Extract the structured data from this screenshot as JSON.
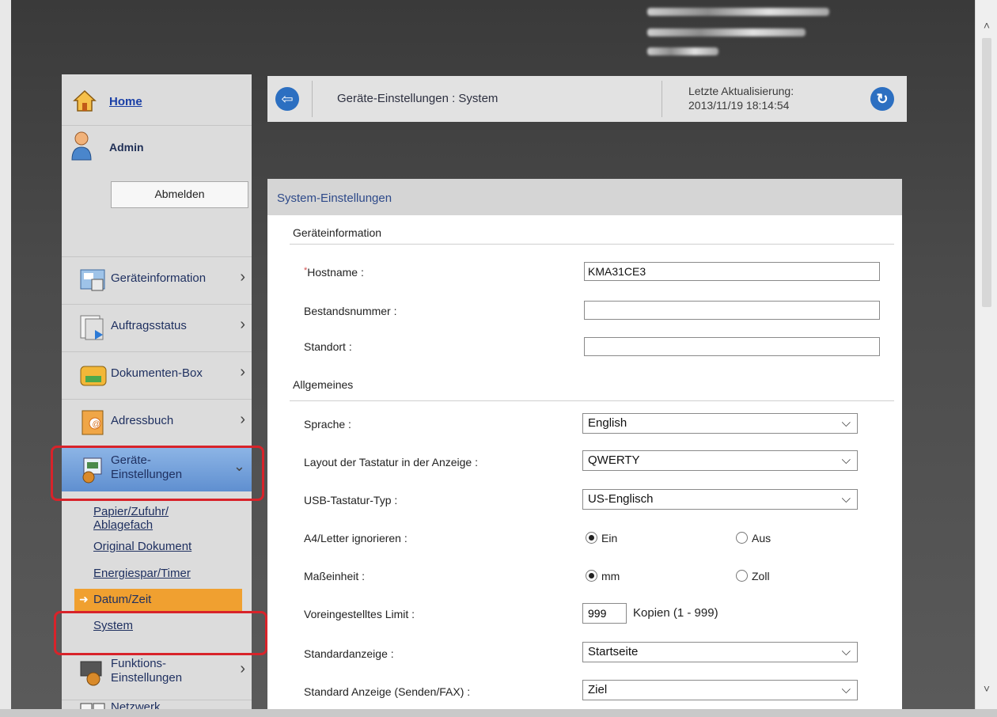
{
  "sidebar": {
    "home": "Home",
    "admin": "Admin",
    "logout": "Abmelden",
    "menu": [
      {
        "label": "Geräteinformation"
      },
      {
        "label": "Auftragsstatus"
      },
      {
        "label": "Dokumenten-Box"
      },
      {
        "label": "Adressbuch"
      },
      {
        "label_line1": "Geräte-",
        "label_line2": "Einstellungen"
      },
      {
        "label_line1": "Funktions-",
        "label_line2": "Einstellungen"
      },
      {
        "label": "Netzwerk"
      }
    ],
    "submenu": {
      "papier_line1": "Papier/Zufuhr/",
      "papier_line2": "Ablagefach",
      "original": "Original Dokument",
      "energie": "Energiespar/Timer",
      "datum": "Datum/Zeit",
      "system": "System"
    }
  },
  "header": {
    "breadcrumb": "Geräte-Einstellungen : System",
    "update_label": "Letzte Aktualisierung:",
    "update_time": "2013/11/19 18:14:54"
  },
  "panel": {
    "title": "System-Einstellungen",
    "section_info": "Geräteinformation",
    "hostname_label": "Hostname :",
    "hostname_value": "KMA31CE3",
    "bestandsnummer_label": "Bestandsnummer :",
    "bestandsnummer_value": "",
    "standort_label": "Standort :",
    "standort_value": "",
    "section_general": "Allgemeines",
    "sprache_label": "Sprache :",
    "sprache_value": "English",
    "layout_label": "Layout der Tastatur in der Anzeige :",
    "layout_value": "QWERTY",
    "usb_label": "USB-Tastatur-Typ :",
    "usb_value": "US-Englisch",
    "a4_label": "A4/Letter ignorieren :",
    "a4_on": "Ein",
    "a4_off": "Aus",
    "unit_label": "Maßeinheit :",
    "unit_mm": "mm",
    "unit_zoll": "Zoll",
    "limit_label": "Voreingestelltes Limit :",
    "limit_value": "999",
    "limit_suffix": "Kopien (1 - 999)",
    "std_label": "Standardanzeige :",
    "std_value": "Startseite",
    "std_fax_label": "Standard Anzeige (Senden/FAX) :",
    "std_fax_value": "Ziel"
  },
  "icons": {
    "home": "house-icon",
    "admin": "admin-user-icon",
    "back": "back-arrow-icon",
    "refresh": "refresh-icon",
    "chevron": "chevron-right-icon",
    "chevron_down": "chevron-down-icon"
  },
  "colors": {
    "highlight_box": "#d8232a",
    "active_menu": "#6b9bd6",
    "active_submenu": "#f0a030",
    "link": "#1a3fa6",
    "accent_button": "#2c6fc1"
  }
}
